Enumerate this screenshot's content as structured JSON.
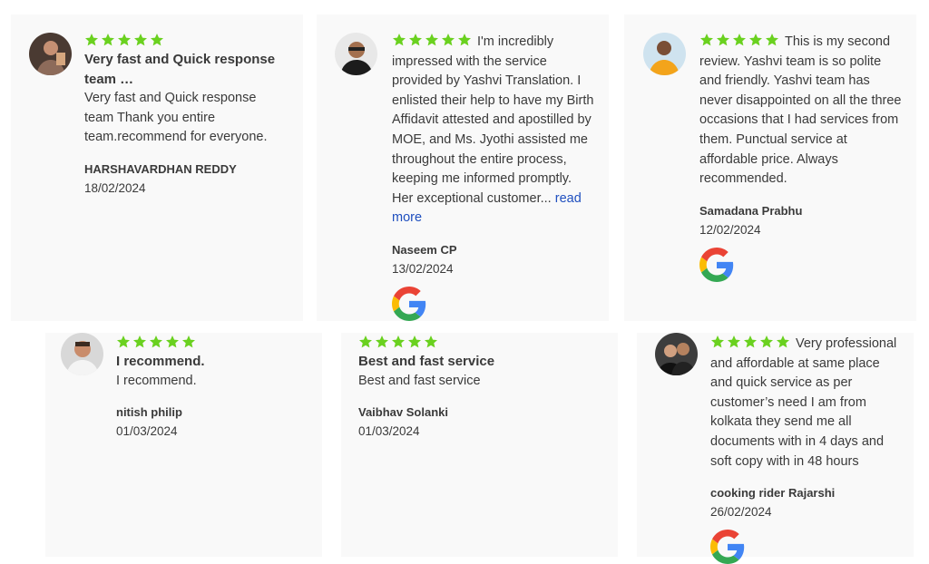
{
  "colors": {
    "star": "#6ad11f",
    "card_bg": "#f9f9f9",
    "text": "#3a3a3a",
    "link": "#1f4fbf"
  },
  "reviews": [
    {
      "rating": 5,
      "title": "Very fast and Quick response team …",
      "text": "Very fast and Quick response team Thank you entire team.recommend for everyone.",
      "author": "HARSHAVARDHAN REDDY",
      "date": "18/02/2024"
    },
    {
      "rating": 5,
      "text": "I'm incredibly impressed with the service provided by Yashvi Translation. I enlisted their help to have my Birth Affidavit attested and apostilled by MOE, and Ms. Jyothi assisted me throughout the entire process, keeping me informed promptly. Her exceptional customer...",
      "more_label": "read more",
      "author": "Naseem CP",
      "date": "13/02/2024",
      "icon": "google-icon"
    },
    {
      "rating": 5,
      "text": "This is my second review. Yashvi team is so polite and friendly. Yashvi team has never disappointed on all the three occasions that I had services from them. Punctual service at affordable price. Always recommended.",
      "author": "Samadana Prabhu",
      "date": "12/02/2024",
      "icon": "google-icon"
    },
    {
      "rating": 5,
      "title": "I recommend.",
      "text": "I recommend.",
      "author": "nitish philip",
      "date": "01/03/2024"
    },
    {
      "rating": 5,
      "title": "Best and fast service",
      "text": "Best and fast service",
      "author": "Vaibhav Solanki",
      "date": "01/03/2024"
    },
    {
      "rating": 5,
      "text": "Very professional and affordable at same place and quick service as per customer’s need I am from kolkata they send me all documents with in 4 days and soft copy with in 48 hours",
      "author": "cooking rider Rajarshi",
      "date": "26/02/2024",
      "icon": "google-icon"
    }
  ]
}
